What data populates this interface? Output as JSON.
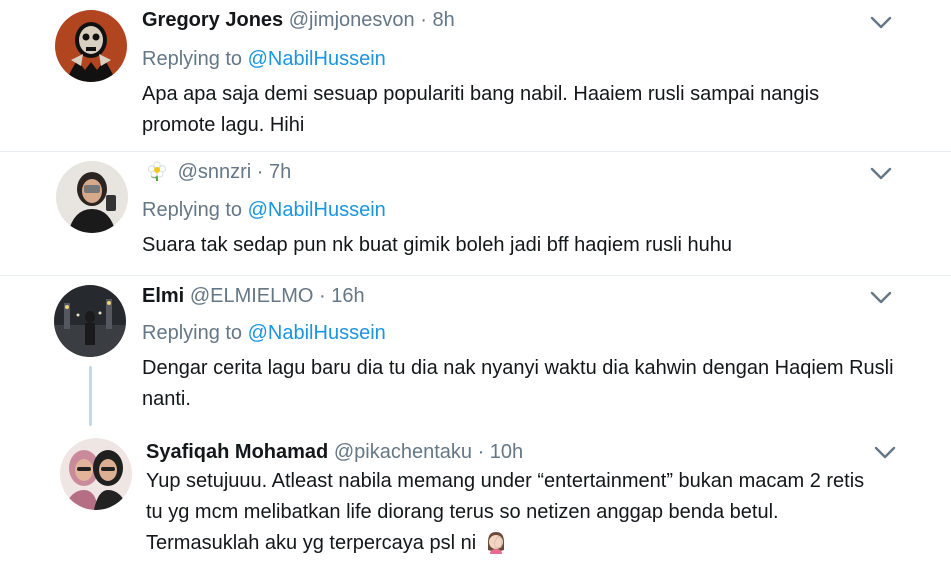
{
  "reply_prefix": "Replying to",
  "tweets": [
    {
      "name": "Gregory Jones",
      "handle": "@jimjonesvon",
      "dot": "·",
      "time": "8h",
      "mention": "@NabilHussein",
      "text": "Apa apa saja demi sesuap populariti bang nabil. Haaiem rusli sampai nangis promote lagu. Hihi"
    },
    {
      "name": "",
      "handle": "@snnzri",
      "dot": "·",
      "time": "7h",
      "mention": "@NabilHussein",
      "text": "Suara tak sedap pun nk buat gimik boleh jadi bff haqiem rusli huhu"
    },
    {
      "name": "Elmi",
      "handle": "@ELMIELMO",
      "dot": "·",
      "time": "16h",
      "mention": "@NabilHussein",
      "text": "Dengar cerita lagu baru dia tu dia nak nyanyi waktu dia kahwin dengan Haqiem Rusli nanti."
    },
    {
      "name": "Syafiqah Mohamad",
      "handle": "@pikachentaku",
      "dot": "·",
      "time": "10h",
      "text": "Yup setujuuu. Atleast nabila memang under “entertainment” bukan macam 2 retis tu yg mcm melibatkan life diorang terus so netizen anggap benda betul. Termasuklah aku yg terpercaya psl ni"
    }
  ],
  "colors": {
    "name": "#14171a",
    "secondary": "#657786",
    "link": "#1b95e0",
    "divider": "#e6ecf0",
    "thread_line": "#c4d8ea"
  },
  "icons": {
    "menu": "chevron-down-icon",
    "display_name_emoji": "flower-icon",
    "text_emoji": "woman-facepalming-emoji"
  }
}
